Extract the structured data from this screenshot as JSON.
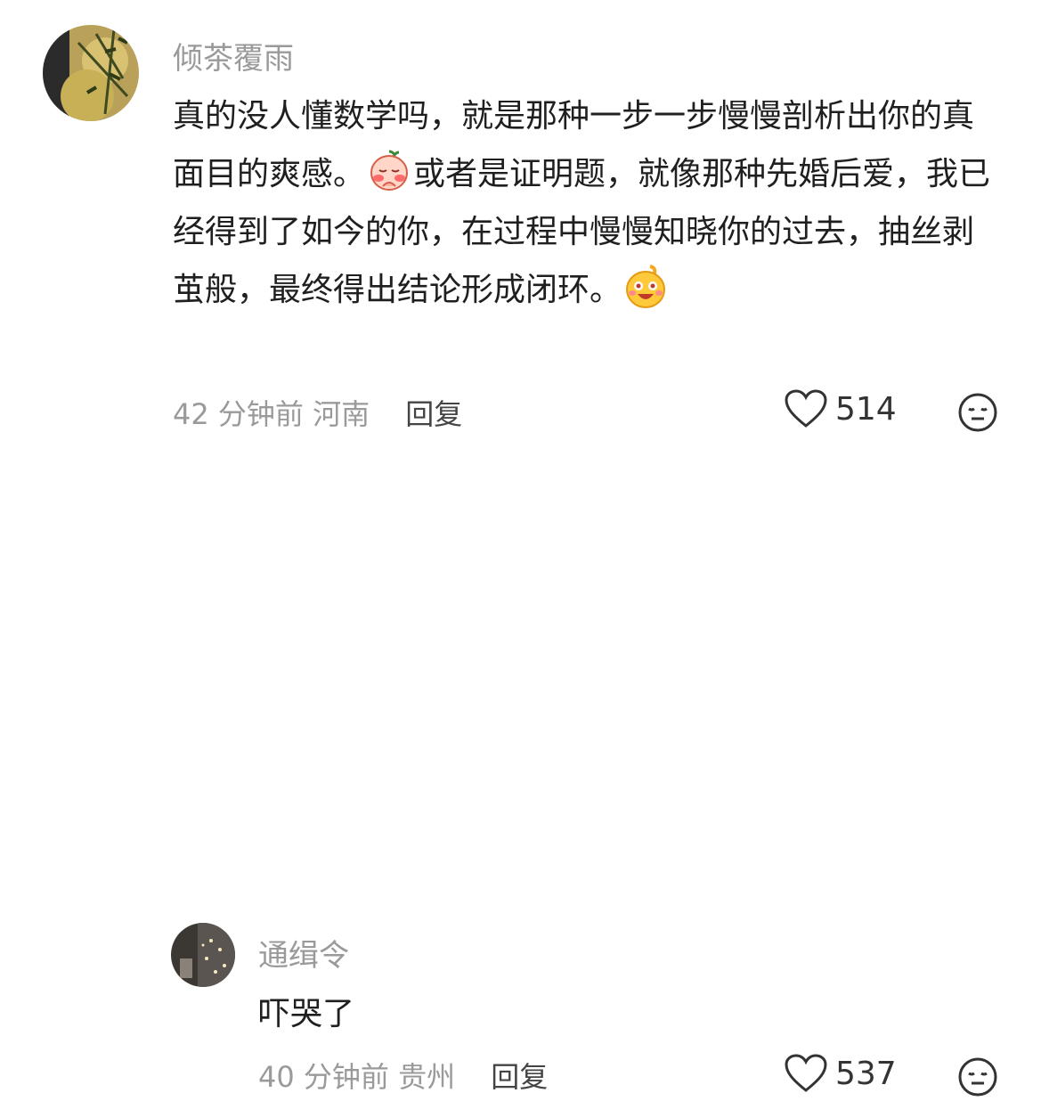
{
  "comments": [
    {
      "username": "倾茶覆雨",
      "text_parts": [
        "真的没人懂数学吗，就是那种一步一步慢慢剖析出你的真面目的爽感。",
        "或者是证明题，就像那种先婚后爱，我已经得到了如今的你，在过程中慢慢知晓你的过去，抽丝剥茧般，最终得出结论形成闭环。",
        ""
      ],
      "time": "42 分钟前",
      "location": "河南",
      "reply_label": "回复",
      "likes": "514",
      "icons": {
        "emoji_1": "blushing-face-icon",
        "emoji_2": "grinning-face-icon",
        "like": "heart-outline-icon",
        "dislike": "neutral-face-icon"
      }
    },
    {
      "username": "通缉令",
      "text": "吓哭了",
      "time": "40 分钟前",
      "location": "贵州",
      "reply_label": "回复",
      "likes": "537",
      "icons": {
        "like": "heart-outline-icon",
        "dislike": "neutral-face-icon"
      }
    }
  ]
}
